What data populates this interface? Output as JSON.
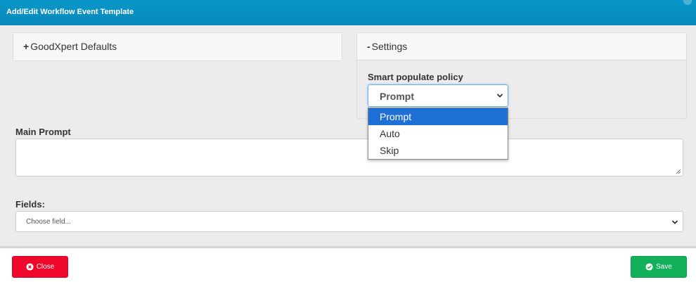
{
  "header": {
    "title": "Add/Edit Workflow Event Template"
  },
  "panels": {
    "defaults": {
      "sign": "+",
      "title": "GoodXpert Defaults"
    },
    "settings": {
      "sign": "-",
      "title": "Settings"
    }
  },
  "smart_populate": {
    "label": "Smart populate policy",
    "selected": "Prompt",
    "options": [
      "Prompt",
      "Auto",
      "Skip"
    ]
  },
  "main_prompt": {
    "label": "Main Prompt",
    "value": ""
  },
  "fields": {
    "label": "Fields:",
    "placeholder": "Choose field..."
  },
  "footer": {
    "close_label": "Close",
    "save_label": "Save"
  },
  "colors": {
    "header": "#0889bb",
    "close": "#f0082c",
    "save": "#12b05a",
    "selected_option": "#1e6fd6"
  },
  "icons": {
    "close": "times-circle-icon",
    "save": "check-circle-icon",
    "select_arrow": "chevron-down-icon"
  }
}
